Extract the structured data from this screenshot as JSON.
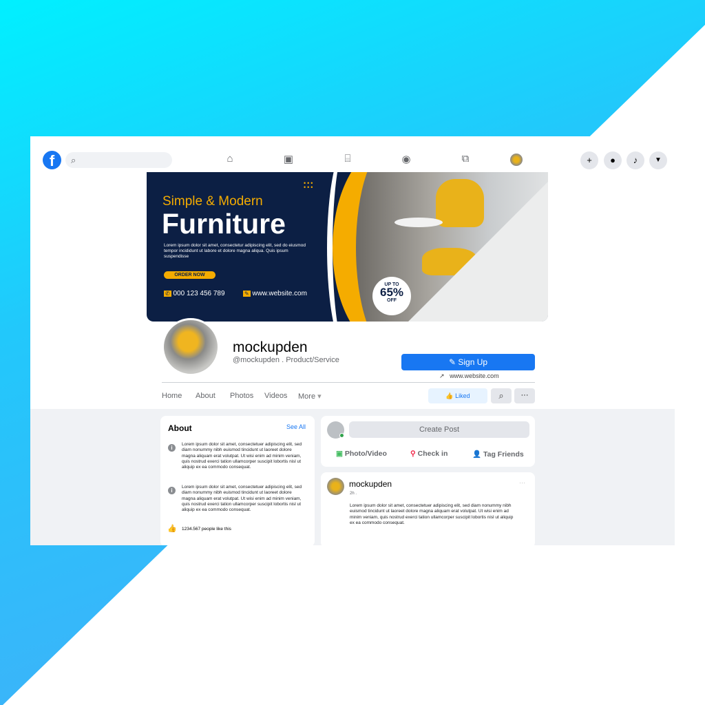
{
  "topbar": {
    "logo": "f",
    "search_placeholder": "",
    "nav_icons": [
      "home-icon",
      "watch-icon",
      "marketplace-icon",
      "groups-icon",
      "gaming-icon",
      "profile-icon"
    ],
    "right_icons": [
      "plus-icon",
      "messenger-icon",
      "bell-icon",
      "caret-down-icon"
    ]
  },
  "cover": {
    "subtitle": "Simple & Modern",
    "title": "Furniture",
    "body": "Lorem ipsum dolor sit amet, consectetur adipiscing elit, sed do eiusmod tempor incididunt ut labore et dolore magna aliqua. Quis ipsum suspendisse",
    "cta": "ORDER NOW",
    "phone": "000 123 456 789",
    "website": "www.website.com",
    "badge_top": "UP TO",
    "badge_value": "65%",
    "badge_bottom": "OFF",
    "colors": {
      "navy": "#0c1f44",
      "yellow": "#f5ac00"
    }
  },
  "profile": {
    "name": "mockupden",
    "handle": "@mockupden . Product/Service",
    "signup": "Sign Up",
    "website": "www.website.com"
  },
  "tabs": [
    "Home",
    "About",
    "Photos",
    "Videos",
    "More"
  ],
  "actions": {
    "liked": "Liked"
  },
  "about": {
    "title": "About",
    "see_all": "See All",
    "items": [
      "Lorem ipsum dolor sit amet, consectetuer adipiscing elit, sed diam nonummy nibh euismod tincidunt ut laoreet dolore magna aliquam erat volutpat. Ut wisi enim ad minim veniam, quis nostrud exerci tation ullamcorper suscipit lobortis nisl ut aliquip ex ea commodo consequat.",
      "Lorem ipsum dolor sit amet, consectetuer adipiscing elit, sed diam nonummy nibh euismod tincidunt ut laoreet dolore magna aliquam erat volutpat. Ut wisi enim ad minim veniam, quis nostrud exerci tation ullamcorper suscipit lobortis nisl ut aliquip ex ea commodo consequat."
    ],
    "likes": "1234.567  people like this"
  },
  "composer": {
    "create_post": "Create Post",
    "photo_video": "Photo/Video",
    "check_in": "Check in",
    "tag_friends": "Tag Friends"
  },
  "post": {
    "author": "mockupden",
    "time": "2h .",
    "more": "···",
    "body": "Lorem ipsum dolor sit amet, consectetuer adipiscing elit, sed diam nonummy nibh euismod tincidunt ut laoreet dolore magna aliquam erat volutpat. Ut wisi enim ad minim veniam, quis nostrud exerci tation ullamcorper suscipit lobortis nisl ut aliquip ex ea commodo consequat."
  }
}
